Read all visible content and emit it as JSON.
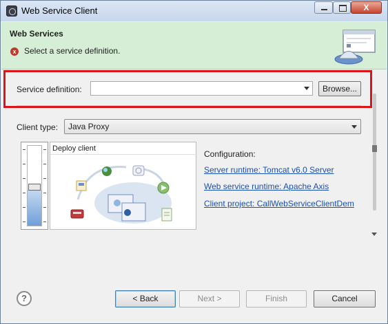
{
  "window": {
    "title": "Web Service Client",
    "close_glyph": "X"
  },
  "header": {
    "title": "Web Services",
    "message": "Select a service definition.",
    "error_glyph": "x"
  },
  "service_definition": {
    "label": "Service definition:",
    "value": "",
    "browse_label": "Browse..."
  },
  "client_type": {
    "label": "Client type:",
    "value": "Java Proxy"
  },
  "deploy_panel": {
    "title": "Deploy client"
  },
  "configuration": {
    "label": "Configuration:",
    "server_runtime": "Server runtime: Tomcat v6.0 Server",
    "web_service_runtime": "Web service runtime: Apache Axis",
    "client_project": "Client project: CallWebServiceClientDem"
  },
  "footer": {
    "help_glyph": "?",
    "back_label": "< Back",
    "next_label": "Next >",
    "finish_label": "Finish",
    "cancel_label": "Cancel"
  },
  "icons": [
    "app-icon",
    "error-icon",
    "wizard-graphic-icon",
    "combo-arrow-icon",
    "help-icon"
  ],
  "colors": {
    "highlight": "#d9151a",
    "header_bg": "#d6eed6",
    "link": "#1a4fb0"
  }
}
